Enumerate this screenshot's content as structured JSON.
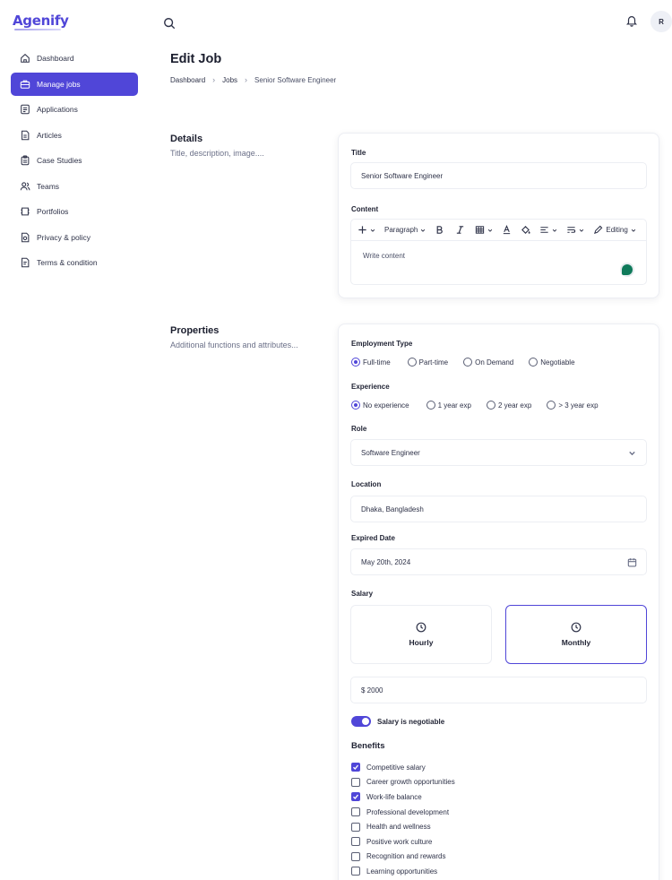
{
  "app": {
    "logo": "Agenify",
    "avatar_initial": "R"
  },
  "sidebar": {
    "items": [
      {
        "label": "Dashboard",
        "icon": "home-icon"
      },
      {
        "label": "Manage jobs",
        "icon": "briefcase-icon",
        "active": true
      },
      {
        "label": "Applications",
        "icon": "document-icon"
      },
      {
        "label": "Articles",
        "icon": "article-icon"
      },
      {
        "label": "Case Studies",
        "icon": "clipboard-icon"
      },
      {
        "label": "Teams",
        "icon": "users-icon"
      },
      {
        "label": "Portfolios",
        "icon": "portfolio-icon"
      },
      {
        "label": "Privacy & policy",
        "icon": "privacy-icon"
      },
      {
        "label": "Terms & condition",
        "icon": "terms-icon"
      }
    ]
  },
  "header": {
    "title": "Edit Job",
    "breadcrumb": [
      "Dashboard",
      "Jobs",
      "Senior Software Engineer"
    ]
  },
  "details": {
    "title": "Details",
    "subtitle": "Title, description, image....",
    "title_label": "Title",
    "title_value": "Senior Software Engineer",
    "content_label": "Content",
    "toolbar": {
      "paragraph": "Paragraph",
      "editing": "Editing"
    },
    "content_placeholder": "Write content"
  },
  "properties": {
    "title": "Properties",
    "subtitle": "Additional functions and attributes...",
    "employment_type": {
      "label": "Employment Type",
      "options": [
        "Full-time",
        "Part-time",
        "On Demand",
        "Negotiable"
      ],
      "selected": "Full-time"
    },
    "experience": {
      "label": "Experience",
      "options": [
        "No experience",
        "1 year exp",
        "2 year exp",
        "> 3 year exp"
      ],
      "selected": "No experience"
    },
    "role": {
      "label": "Role",
      "value": "Software Engineer"
    },
    "location": {
      "label": "Location",
      "value": "Dhaka, Bangladesh"
    },
    "expired_date": {
      "label": "Expired Date",
      "value": "May 20th, 2024"
    },
    "salary": {
      "label": "Salary",
      "options": [
        "Hourly",
        "Monthly"
      ],
      "selected": "Monthly",
      "amount": "$ 2000",
      "negotiable_label": "Salary is negotiable",
      "negotiable": true
    },
    "benefits": {
      "label": "Benefits",
      "items": [
        {
          "label": "Competitive salary",
          "checked": true
        },
        {
          "label": "Career growth opportunities",
          "checked": false
        },
        {
          "label": "Work-life balance",
          "checked": true
        },
        {
          "label": "Professional development",
          "checked": false
        },
        {
          "label": "Health and wellness",
          "checked": false
        },
        {
          "label": "Positive work culture",
          "checked": false
        },
        {
          "label": "Recognition and rewards",
          "checked": false
        },
        {
          "label": "Learning opportunities",
          "checked": false
        }
      ]
    }
  },
  "colors": {
    "accent": "#5046d8",
    "text": "#1f2233",
    "border": "#eceef3"
  }
}
